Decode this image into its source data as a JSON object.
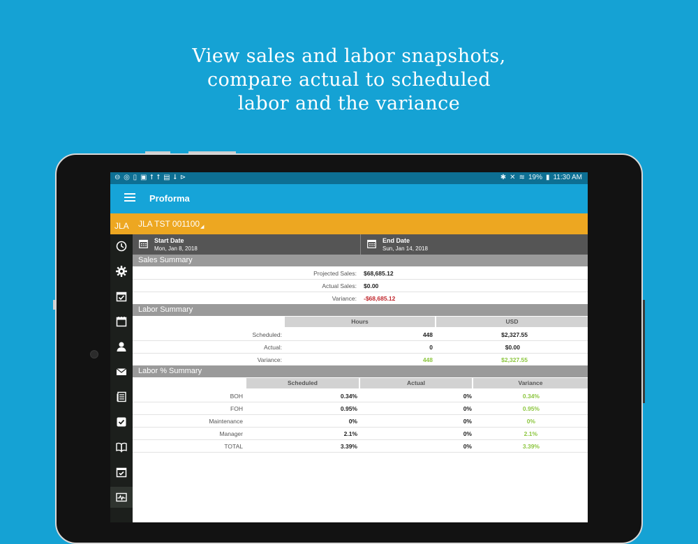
{
  "headline": {
    "line1": "View sales and labor snapshots,",
    "line2": "compare actual to scheduled",
    "line3": "labor and the variance"
  },
  "status_bar": {
    "left_icons": "⊖ ◎ ▯ ▣ ⭡ ⭡ ▤ ⭣ ⊳",
    "battery": "19%",
    "time": "11:30 AM"
  },
  "app": {
    "title": "Proforma"
  },
  "store": {
    "left_fragment": "JLA ",
    "name": "JLA TST 001100"
  },
  "dates": {
    "start_label": "Start Date",
    "start_value": "Mon, Jan 8, 2018",
    "end_label": "End Date",
    "end_value": "Sun, Jan 14, 2018"
  },
  "sales_summary": {
    "title": "Sales Summary",
    "rows": [
      {
        "label": "Projected Sales:",
        "value": "$68,685.12"
      },
      {
        "label": "Actual Sales:",
        "value": "$0.00"
      },
      {
        "label": "Variance:",
        "value": "-$68,685.12"
      }
    ]
  },
  "labor_summary": {
    "title": "Labor Summary",
    "columns": [
      "Hours",
      "USD"
    ],
    "rows": [
      {
        "label": "Scheduled:",
        "hours": "448",
        "usd": "$2,327.55"
      },
      {
        "label": "Actual:",
        "hours": "0",
        "usd": "$0.00"
      },
      {
        "label": "Variance:",
        "hours": "448",
        "usd": "$2,327.55"
      }
    ]
  },
  "labor_pct_summary": {
    "title": "Labor % Summary",
    "columns": [
      "Scheduled",
      "Actual",
      "Variance"
    ],
    "rows": [
      {
        "label": "BOH",
        "scheduled": "0.34%",
        "actual": "0%",
        "variance": "0.34%"
      },
      {
        "label": "FOH",
        "scheduled": "0.95%",
        "actual": "0%",
        "variance": "0.95%"
      },
      {
        "label": "Maintenance",
        "scheduled": "0%",
        "actual": "0%",
        "variance": "0%"
      },
      {
        "label": "Manager",
        "scheduled": "2.1%",
        "actual": "0%",
        "variance": "2.1%"
      },
      {
        "label": "TOTAL",
        "scheduled": "3.39%",
        "actual": "0%",
        "variance": "3.39%"
      }
    ]
  },
  "sidebar_icons": [
    "clock-icon",
    "gear-icon",
    "calendar-check-icon",
    "calendar-icon",
    "user-icon",
    "envelope-icon",
    "document-icon",
    "checkbox-icon",
    "book-icon",
    "calendar-tick-icon",
    "activity-monitor-icon"
  ],
  "colors": {
    "background": "#15a2d4",
    "appbar": "#16a4d8",
    "storebar": "#eda721",
    "negative": "#c1272d",
    "positive": "#8cc63f"
  }
}
